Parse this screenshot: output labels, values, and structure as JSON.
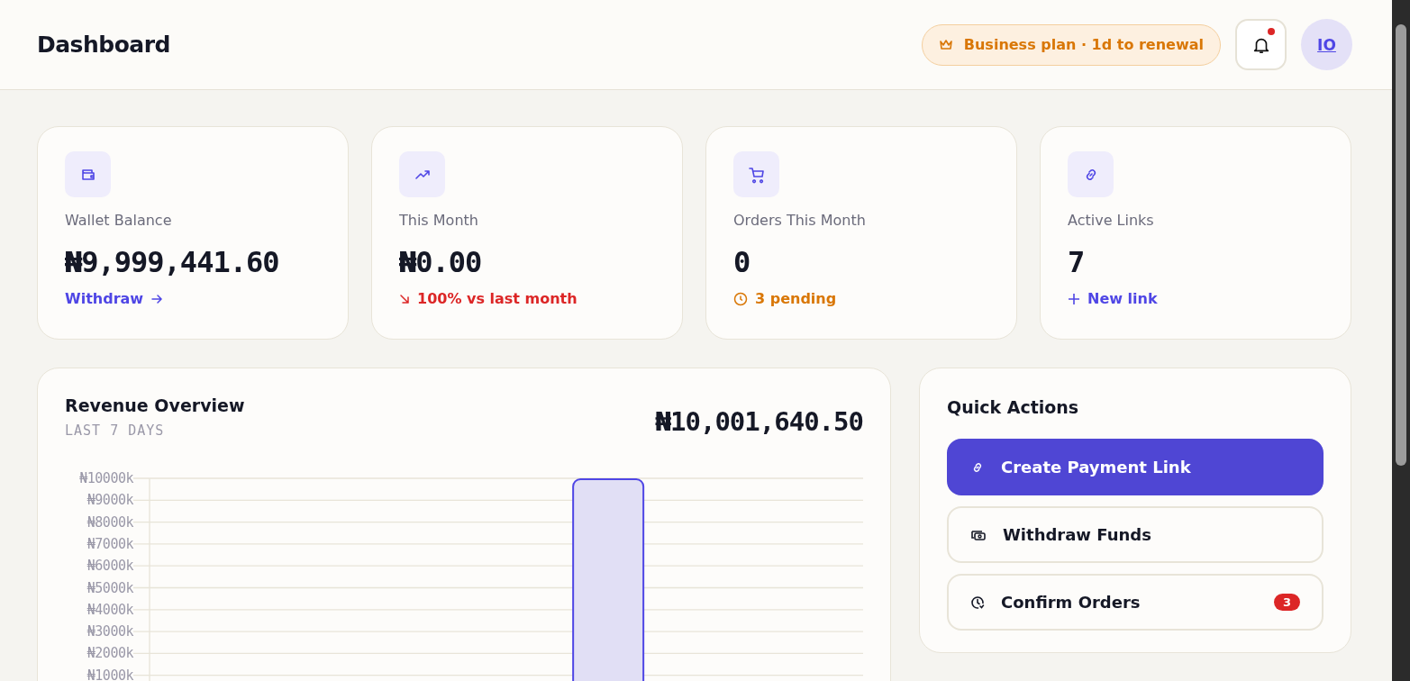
{
  "header": {
    "title": "Dashboard",
    "plan_badge": "Business plan · 1d to renewal",
    "notifications": {
      "unread": true
    },
    "avatar": "IO"
  },
  "stats": [
    {
      "kind": "wallet",
      "label": "Wallet Balance",
      "value": "₦9,999,441.60",
      "footer": {
        "kind": "link-arrow",
        "text": "Withdraw"
      }
    },
    {
      "kind": "trend",
      "label": "This Month",
      "value": "₦0.00",
      "footer": {
        "kind": "down",
        "text": "100% vs last month"
      }
    },
    {
      "kind": "cart",
      "label": "Orders This Month",
      "value": "0",
      "footer": {
        "kind": "pending",
        "text": "3 pending"
      }
    },
    {
      "kind": "link",
      "label": "Active Links",
      "value": "7",
      "footer": {
        "kind": "link-plus",
        "text": "New link"
      }
    }
  ],
  "revenue": {
    "title": "Revenue Overview",
    "subtitle": "LAST 7 DAYS",
    "total": "₦10,001,640.50",
    "chart_data": {
      "type": "bar",
      "values": [
        0,
        0,
        0,
        0,
        10000,
        0,
        0
      ],
      "ylim": [
        0,
        10000
      ],
      "grid": true,
      "yticks": [
        {
          "value": 1000,
          "label": "₦1000k"
        },
        {
          "value": 2000,
          "label": "₦2000k"
        },
        {
          "value": 3000,
          "label": "₦3000k"
        },
        {
          "value": 4000,
          "label": "₦4000k"
        },
        {
          "value": 5000,
          "label": "₦5000k"
        },
        {
          "value": 6000,
          "label": "₦6000k"
        },
        {
          "value": 7000,
          "label": "₦7000k"
        },
        {
          "value": 8000,
          "label": "₦8000k"
        },
        {
          "value": 9000,
          "label": "₦9000k"
        },
        {
          "value": 10000,
          "label": "₦10000k"
        }
      ]
    }
  },
  "quick_actions": {
    "title": "Quick Actions",
    "items": [
      {
        "kind": "link",
        "label": "Create Payment Link",
        "primary": true
      },
      {
        "kind": "cash",
        "label": "Withdraw Funds",
        "primary": false
      },
      {
        "kind": "clock",
        "label": "Confirm Orders",
        "primary": false,
        "badge": "3"
      }
    ]
  }
}
